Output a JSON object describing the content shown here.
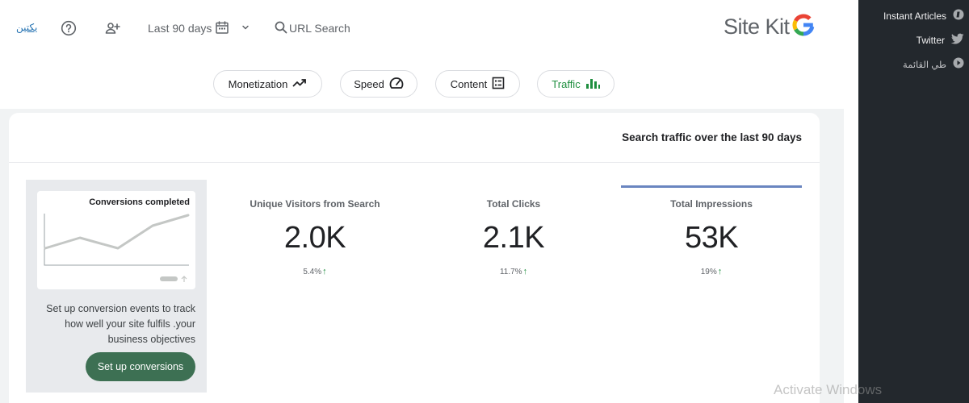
{
  "header": {
    "arabic_link": "يكتين",
    "date_range": "Last 90 days",
    "url_search": "URL Search",
    "brand": "Site Kit",
    "brand_logo_letter": "G"
  },
  "chips": [
    {
      "label": "Monetization",
      "icon": "trending-up-icon",
      "active": false
    },
    {
      "label": "Speed",
      "icon": "speedometer-icon",
      "active": false
    },
    {
      "label": "Content",
      "icon": "content-list-icon",
      "active": false
    },
    {
      "label": "Traffic",
      "icon": "bar-chart-icon",
      "active": true
    }
  ],
  "card": {
    "title": "Search traffic over the last 90 days"
  },
  "promo": {
    "chart_title": "Conversions completed",
    "text": "Set up conversion events to track how well your site fulfils .your business objectives",
    "button": "Set up conversions"
  },
  "metrics": [
    {
      "label": "Unique Visitors from Search",
      "value": "2.0K",
      "change": "5.4%",
      "direction": "up",
      "selected": false
    },
    {
      "label": "Total Clicks",
      "value": "2.1K",
      "change": "11.7%",
      "direction": "up",
      "selected": false
    },
    {
      "label": "Total Impressions",
      "value": "53K",
      "change": "19%",
      "direction": "up",
      "selected": true
    }
  ],
  "sidebar": {
    "items": [
      {
        "label": "Instant Articles",
        "icon": "instant-articles-icon"
      },
      {
        "label": "Twitter",
        "icon": "twitter-icon"
      },
      {
        "label": "طي القائمة",
        "icon": "collapse-menu-icon"
      }
    ]
  },
  "watermark": {
    "title": "Activate Windows"
  },
  "colors": {
    "accent_green": "#3d7053",
    "traffic_green": "#1e8e3e",
    "selected_metric_bar": "#6a85c0",
    "sidebar_bg": "#23282d"
  }
}
